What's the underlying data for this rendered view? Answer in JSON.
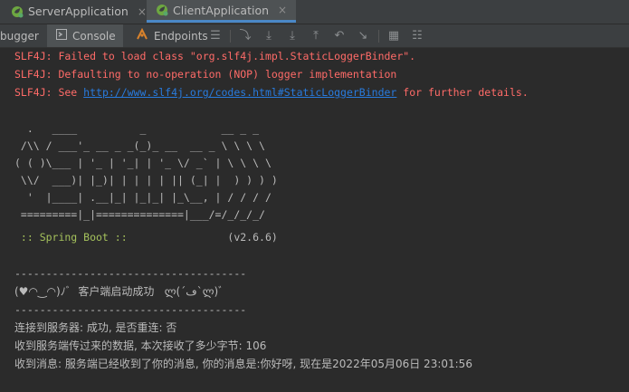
{
  "run_tabs": [
    {
      "label": "ServerApplication",
      "close": "×"
    },
    {
      "label": "ClientApplication",
      "close": "×"
    }
  ],
  "tool_tabs": [
    {
      "label": "bugger"
    },
    {
      "label": "Console"
    },
    {
      "label": "Endpoints"
    }
  ],
  "console": {
    "slf4j_1": "SLF4J: Failed to load class \"org.slf4j.impl.StaticLoggerBinder\".",
    "slf4j_2": "SLF4J: Defaulting to no-operation (NOP) logger implementation",
    "slf4j_3_prefix": "SLF4J: See ",
    "slf4j_3_link": "http://www.slf4j.org/codes.html#StaticLoggerBinder",
    "slf4j_3_suffix": " for further details.",
    "banner": [
      "  .   ____          _            __ _ _",
      " /\\\\ / ___'_ __ _ _(_)_ __  __ _ \\ \\ \\ \\",
      "( ( )\\___ | '_ | '_| | '_ \\/ _` | \\ \\ \\ \\",
      " \\\\/  ___)| |_)| | | | | || (_| |  ) ) ) )",
      "  '  |____| .__|_| |_|_| |_\\__, | / / / /",
      " =========|_|==============|___/=/_/_/_/"
    ],
    "spring_label": " :: Spring Boot :: ",
    "spring_version": "               (v2.6.6)",
    "divider_1": "-------------------------------------",
    "success_banner": "(♥◠‿◠)ﾉﾞ  客户端启动成功   ლ(´ڡ`ლ)ﾞ",
    "divider_2": "-------------------------------------",
    "msg_connect": "连接到服务器: 成功, 是否重连: 否",
    "msg_received": "收到服务端传过来的数据, 本次接收了多少字节: 106",
    "msg_message": "收到消息: 服务端已经收到了你的消息, 你的消息是:你好呀, 现在是2022年05月06日 23:01:56"
  },
  "colors": {
    "error": "#ff6b68",
    "link": "#287bde",
    "spring": "#a5c25c",
    "accent": "#4a88c7"
  }
}
